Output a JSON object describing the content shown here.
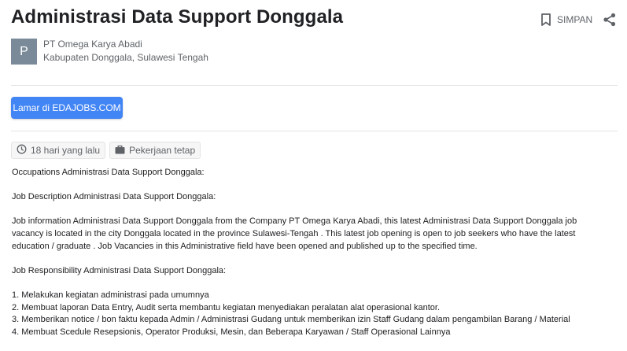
{
  "job": {
    "title": "Administrasi Data Support Donggala",
    "save_label": "SIMPAN",
    "company": "PT Omega Karya Abadi",
    "company_initial": "P",
    "location": "Kabupaten Donggala, Sulawesi Tengah",
    "apply_label": "Lamar di EDAJOBS.COM",
    "posted": "18 hari yang lalu",
    "job_type": "Pekerjaan tetap"
  },
  "colors": {
    "accent": "#4285f4",
    "logo_bg": "#7a8a99"
  },
  "icons": {
    "save": "bookmark-icon",
    "share": "share-icon",
    "posted": "clock-icon",
    "job_type": "briefcase-icon"
  },
  "description": {
    "occupations": "Occupations Administrasi Data Support Donggala:",
    "job_desc_heading": "Job Description Administrasi Data Support Donggala:",
    "job_info": "Job information Administrasi Data Support Donggala from the Company PT Omega Karya Abadi, this latest Administrasi Data Support Donggala job vacancy is located in the city Donggala located in the province Sulawesi-Tengah . This latest job opening is open to job seekers who have the latest education / graduate . Job Vacancies in this Administrative field have been opened and published up to the specified time.",
    "responsibility_heading": "Job Responsibility Administrasi Data Support Donggala:",
    "items": [
      "1. Melakukan kegiatan administrasi pada umumnya",
      "2. Membuat laporan Data Entry, Audit serta membantu kegiatan menyediakan peralatan alat operasional kantor.",
      "3. Memberikan notice / bon faktu kepada Admin / Administrasi Gudang untuk memberikan izin Staff Gudang dalam pengambilan Barang / Material",
      "4. Membuat Scedule Resepsionis, Operator Produksi, Mesin, dan Beberapa Karyawan / Staff Operasional Lainnya"
    ]
  }
}
